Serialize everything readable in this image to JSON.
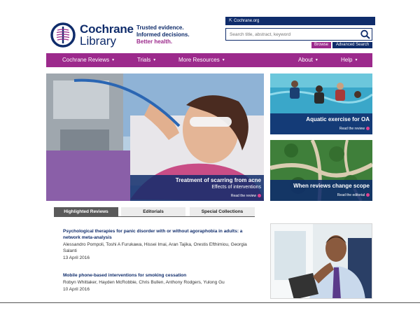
{
  "brand": {
    "name_line1": "Cochrane",
    "name_line2": "Library",
    "tagline": [
      "Trusted evidence.",
      "Informed decisions.",
      "Better health."
    ]
  },
  "header": {
    "org_link": "Cochrane.org",
    "search_placeholder": "Search title, abstract, keyword",
    "browse_label": "Browse",
    "advanced_label": "Advanced Search"
  },
  "nav": {
    "left": [
      {
        "label": "Cochrane Reviews"
      },
      {
        "label": "Trials"
      },
      {
        "label": "More Resources"
      }
    ],
    "right": [
      {
        "label": "About"
      },
      {
        "label": "Help"
      }
    ]
  },
  "hero": {
    "title": "Treatment of scarring from acne",
    "subtitle": "Effects of interventions",
    "link": "Read the review"
  },
  "side_cards": [
    {
      "title": "Aquatic exercise for OA",
      "link": "Read the review"
    },
    {
      "title": "When reviews change scope",
      "link": "Read the editorial"
    }
  ],
  "tabs": [
    {
      "label": "Highlighted Reviews",
      "active": true
    },
    {
      "label": "Editorials",
      "active": false
    },
    {
      "label": "Special Collections",
      "active": false
    }
  ],
  "articles": [
    {
      "title": "Psychological therapies for panic disorder with or without agoraphobia in adults: a network meta-analysis",
      "authors": "Alessandro Pompoli, Toshi A Furukawa, Hissei Imai, Aran Tajika, Orestis Efthimiou, Georgia Salanti",
      "date": "13 April 2016"
    },
    {
      "title": "Mobile phone-based interventions for smoking cessation",
      "authors": "Robyn Whittaker, Hayden McRobbie, Chris Bullen, Anthony Rodgers, Yulong Gu",
      "date": "10 April 2016"
    }
  ],
  "colors": {
    "navy": "#0f2c6b",
    "purple": "#9c2a8c",
    "pink": "#e0418f"
  },
  "icons": [
    "cochrane-logo-icon",
    "external-link-icon",
    "search-icon",
    "caret-down-icon",
    "arrow-right-icon"
  ]
}
